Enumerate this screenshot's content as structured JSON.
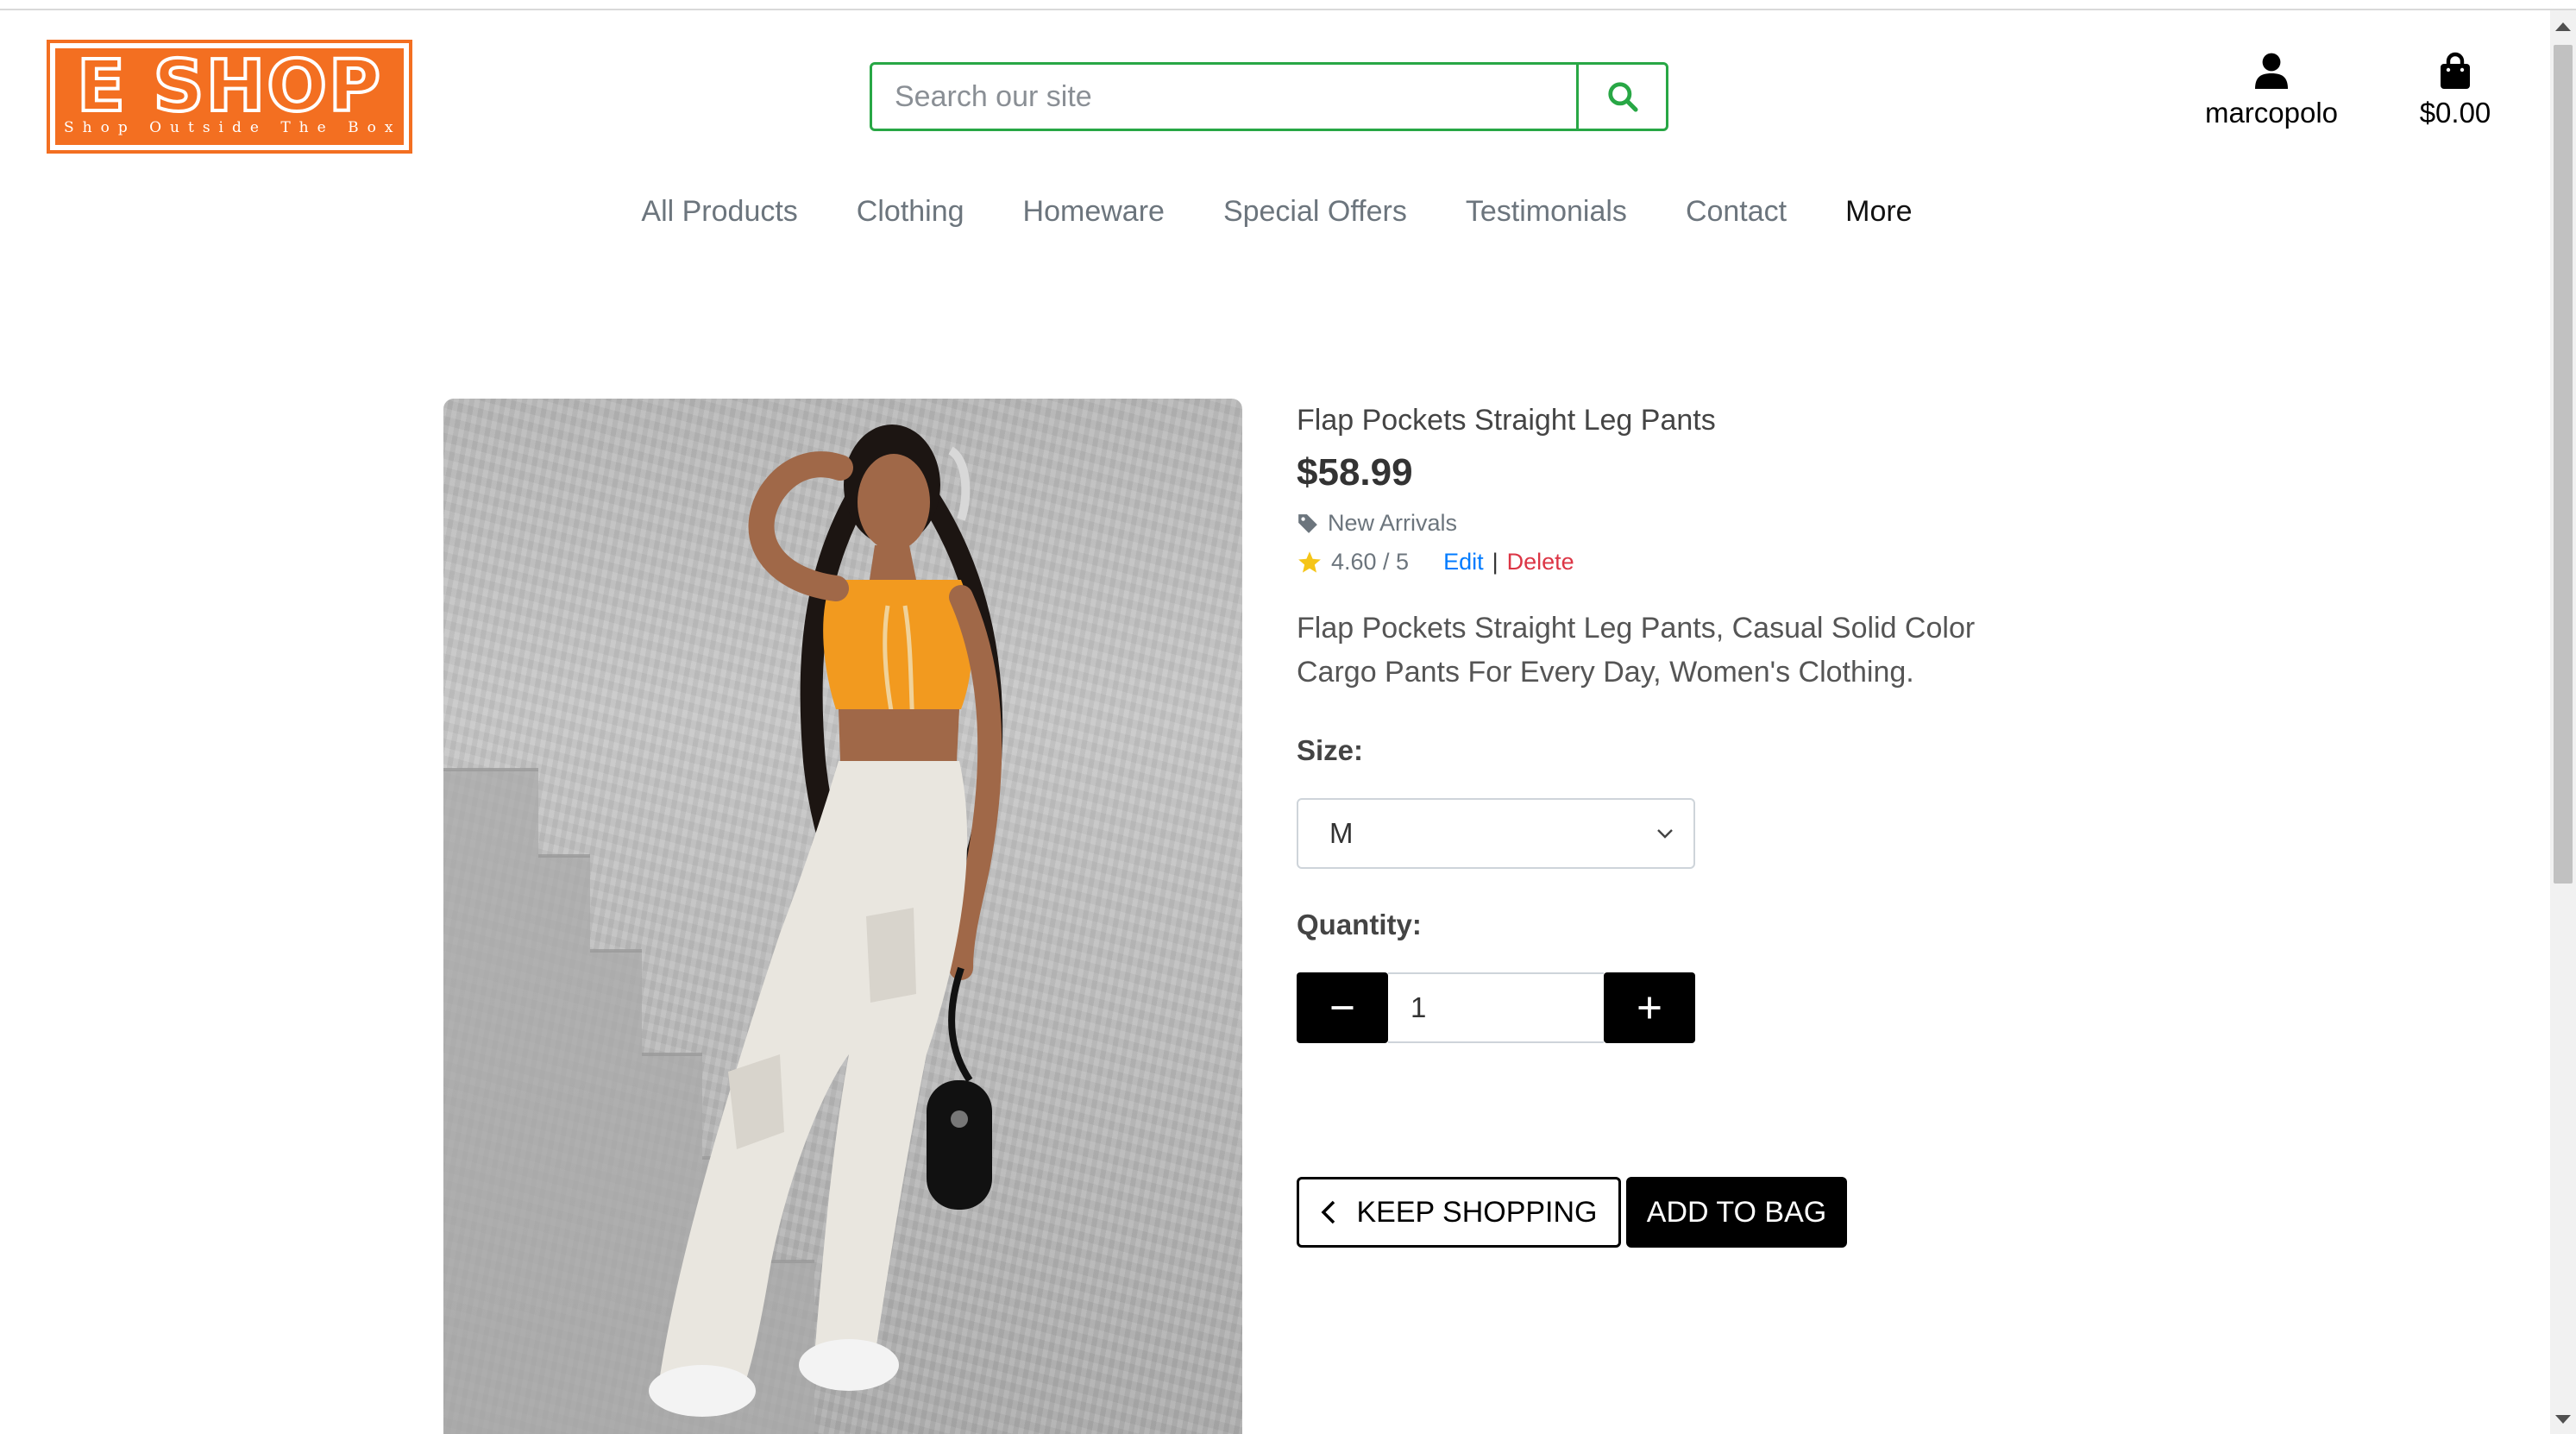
{
  "brand": {
    "name": "E SHOP",
    "tagline": "Shop Outside The Box",
    "accent_color": "#f36f21"
  },
  "search": {
    "placeholder": "Search our site",
    "button_icon": "search-icon",
    "accent_color": "#28a745"
  },
  "account": {
    "username": "marcopolo",
    "user_icon": "user-icon",
    "bag_total": "$0.00",
    "bag_icon": "shopping-bag-icon"
  },
  "nav": {
    "items": [
      "All Products",
      "Clothing",
      "Homeware",
      "Special Offers",
      "Testimonials",
      "Contact",
      "More"
    ]
  },
  "product": {
    "name": "Flap Pockets Straight Leg Pants",
    "price": "$58.99",
    "category": "New Arrivals",
    "category_icon": "tag-icon",
    "rating": "4.60 / 5",
    "rating_icon": "star-icon",
    "edit_label": "Edit",
    "separator": "|",
    "delete_label": "Delete",
    "description": "Flap Pockets Straight Leg Pants, Casual Solid Color Cargo Pants For Every Day, Women's Clothing.",
    "size_label": "Size:",
    "size_value": "M",
    "quantity_label": "Quantity:",
    "quantity_value": "1"
  },
  "actions": {
    "keep_shopping": "KEEP SHOPPING",
    "add_to_bag": "ADD TO BAG"
  },
  "colors": {
    "link_blue": "#007bff",
    "delete_red": "#dc3545",
    "star_gold": "#f5c518"
  }
}
